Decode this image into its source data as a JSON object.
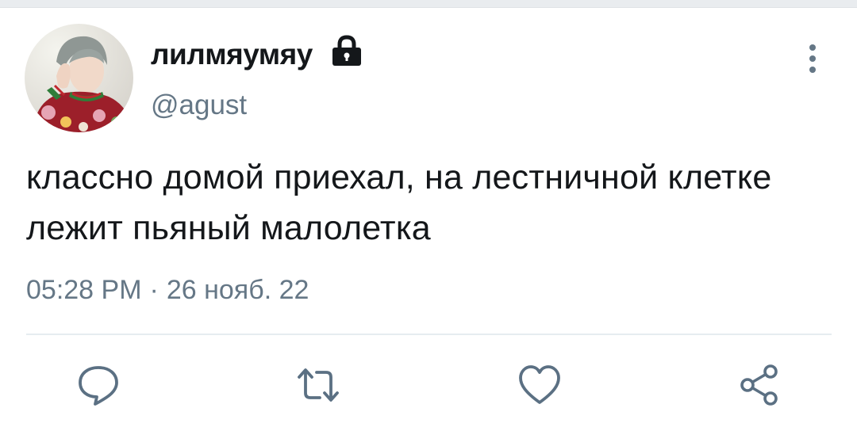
{
  "user": {
    "display_name": "лилмяумяу",
    "handle": "@agust",
    "verified_icon": "lock-icon",
    "avatar_icon": "avatar"
  },
  "tweet": {
    "text": "классно домой приехал, на лестничной клетке лежит пьяный малолетка",
    "time": "05:28 PM",
    "separator": "·",
    "date": "26 нояб. 22"
  },
  "actions": {
    "reply_icon": "reply-icon",
    "retweet_icon": "retweet-icon",
    "like_icon": "heart-icon",
    "share_icon": "share-icon"
  },
  "colors": {
    "text": "#14171a",
    "muted": "#657786",
    "icon": "#5b7083",
    "divider": "#e6ecf0"
  }
}
